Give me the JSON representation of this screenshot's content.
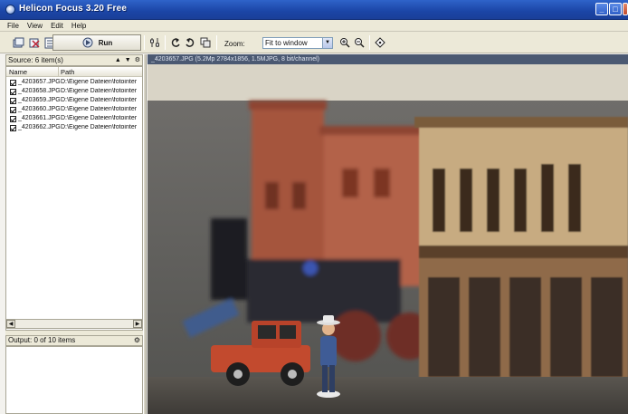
{
  "window": {
    "title": "Helicon Focus 3.20 Free"
  },
  "menu": [
    "File",
    "View",
    "Edit",
    "Help"
  ],
  "toolbar": {
    "run_label": "Run",
    "zoom_label": "Zoom:",
    "zoom_value": "Fit to window"
  },
  "source": {
    "header": "Source: 6 item(s)",
    "columns": {
      "name": "Name",
      "path": "Path"
    },
    "files": [
      {
        "name": "_4203657.JPG",
        "path": "D:\\Eigene Dateien\\fotointer"
      },
      {
        "name": "_4203658.JPG",
        "path": "D:\\Eigene Dateien\\fotointer"
      },
      {
        "name": "_4203659.JPG",
        "path": "D:\\Eigene Dateien\\fotointer"
      },
      {
        "name": "_4203660.JPG",
        "path": "D:\\Eigene Dateien\\fotointer"
      },
      {
        "name": "_4203661.JPG",
        "path": "D:\\Eigene Dateien\\fotointer"
      },
      {
        "name": "_4203662.JPG",
        "path": "D:\\Eigene Dateien\\fotointer"
      }
    ]
  },
  "output": {
    "header": "Output: 0 of 10 items"
  },
  "image": {
    "info": "_4203657.JPG (5.2Mp 2784x1856, 1.5MJPG, 8 bit/channel)"
  },
  "colors": {
    "titlebar": "#1b45a6",
    "panel": "#ece9d8",
    "infobar": "#4b5972"
  }
}
